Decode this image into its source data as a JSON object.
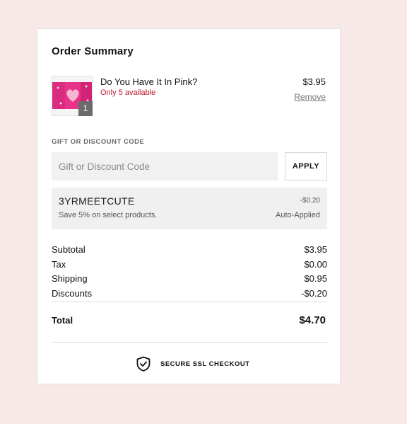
{
  "order_summary": {
    "title": "Order Summary",
    "item": {
      "name": "Do You Have It In Pink?",
      "stock": "Only 5 available",
      "quantity": "1",
      "price": "$3.95",
      "remove_label": "Remove",
      "thumbnail_colors": [
        "#e8338a",
        "#f7b6d2",
        "#c91d6f"
      ]
    },
    "discount_code": {
      "label": "GIFT OR DISCOUNT CODE",
      "placeholder": "Gift or Discount Code",
      "value": "",
      "apply_label": "APPLY"
    },
    "applied_discount": {
      "code": "3YRMEETCUTE",
      "description": "Save 5% on select products.",
      "amount": "-$0.20",
      "status": "Auto-Applied"
    },
    "totals": [
      {
        "label": "Subtotal",
        "value": "$3.95"
      },
      {
        "label": "Tax",
        "value": "$0.00"
      },
      {
        "label": "Shipping",
        "value": "$0.95"
      },
      {
        "label": "Discounts",
        "value": "-$0.20"
      }
    ],
    "total": {
      "label": "Total",
      "value": "$4.70"
    },
    "secure": {
      "icon": "shield-check-icon",
      "label": "SECURE SSL CHECKOUT"
    }
  },
  "colors": {
    "page_background": "#f7e9e8",
    "card_background": "#ffffff",
    "stock_warning": "#c0182f",
    "input_background": "#f1f1f1"
  }
}
